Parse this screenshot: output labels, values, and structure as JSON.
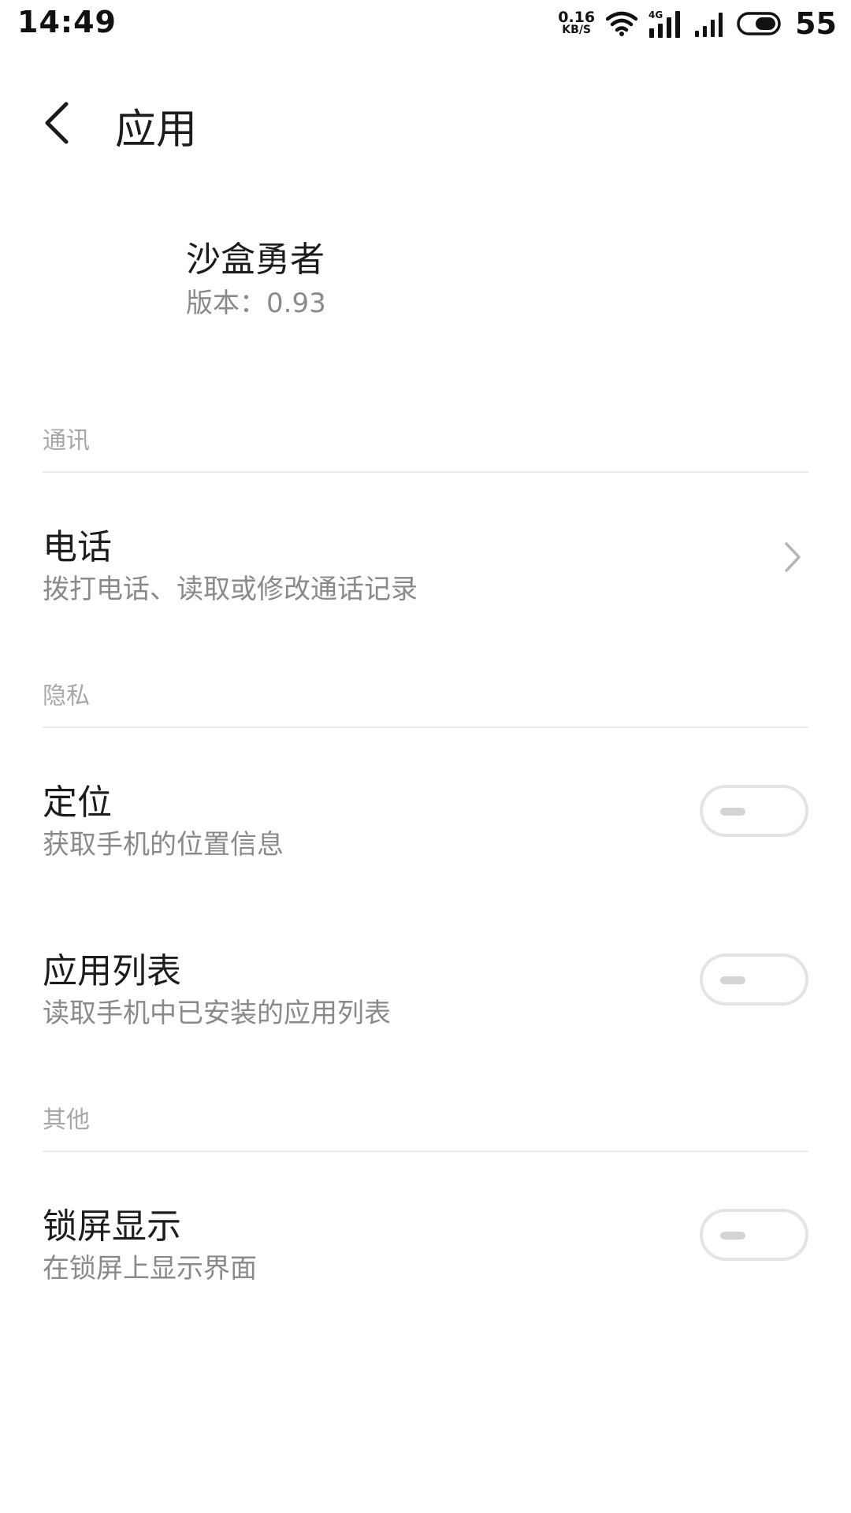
{
  "status_bar": {
    "time": "14:49",
    "net_speed_value": "0.16",
    "net_speed_unit": "KB/S",
    "network_type": "4G",
    "battery_level": "55",
    "icons": [
      "wifi-icon",
      "signal-4g-icon",
      "signal-icon",
      "battery-icon"
    ]
  },
  "header": {
    "title": "应用",
    "back_icon": "chevron-left-icon"
  },
  "app": {
    "name": "沙盒勇者",
    "version": "版本：0.93"
  },
  "sections": {
    "communication": {
      "header": "通讯",
      "items": [
        {
          "title": "电话",
          "subtitle": "拨打电话、读取或修改通话记录",
          "control": "chevron-right-icon"
        }
      ]
    },
    "privacy": {
      "header": "隐私",
      "items": [
        {
          "title": "定位",
          "subtitle": "获取手机的位置信息",
          "control": "toggle",
          "enabled": false
        },
        {
          "title": "应用列表",
          "subtitle": "读取手机中已安装的应用列表",
          "control": "toggle",
          "enabled": false
        }
      ]
    },
    "other": {
      "header": "其他",
      "items": [
        {
          "title": "锁屏显示",
          "subtitle": "在锁屏上显示界面",
          "control": "toggle",
          "enabled": false
        }
      ]
    }
  },
  "colors": {
    "background": "#ffffff",
    "primary_text": "#1c1c1c",
    "secondary_text": "#8a8a8a",
    "section_text": "#a8a8a8",
    "divider": "#ececec",
    "toggle_border": "#e4e4e4"
  }
}
